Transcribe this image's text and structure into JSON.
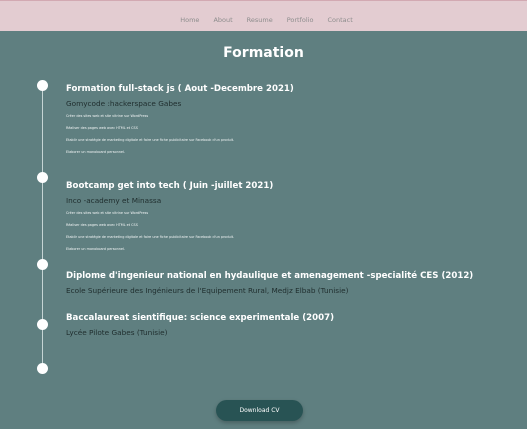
{
  "nav": {
    "items": [
      {
        "label": "Home"
      },
      {
        "label": "About"
      },
      {
        "label": "Resume"
      },
      {
        "label": "Portfolio"
      },
      {
        "label": "Contact"
      }
    ]
  },
  "section": {
    "title": "Formation"
  },
  "timeline": [
    {
      "title": "Formation full-stack js ( Aout -Decembre 2021)",
      "org": "Gomycode :hackerspace Gabes",
      "details": [
        "Créer des sites web et site vitrine sur WordPress",
        "Réaliser des pages web avec HTML et CSS",
        "Etablir une stratégie de marketing digitale et faire une fiche publicitaire sur Facebook d'un produit.",
        "Elaborer un monoboard personnel."
      ]
    },
    {
      "title": "Bootcamp get into tech ( Juin -juillet 2021)",
      "org": "Inco -academy et Minassa",
      "details": [
        "Créer des sites web et site vitrine sur WordPress",
        "Réaliser des pages web avec HTML et CSS",
        "Etablir une stratégie de marketing digitale et faire une fiche publicitaire sur Facebook d'un produit.",
        "Elaborer un monoboard personnel."
      ]
    },
    {
      "title": "Diplome d'ingenieur national en hydaulique et amenagement -specialité CES (2012)",
      "org": "Ecole Supérieure des Ingénieurs de l'Equipement Rural, Medjz Elbab (Tunisie)",
      "details": []
    },
    {
      "title": "Baccalaureat sientifique: science experimentale (2007)",
      "org": "Lycée Pilote Gabes (Tunisie)",
      "details": []
    }
  ],
  "download": {
    "label": "Download CV"
  }
}
